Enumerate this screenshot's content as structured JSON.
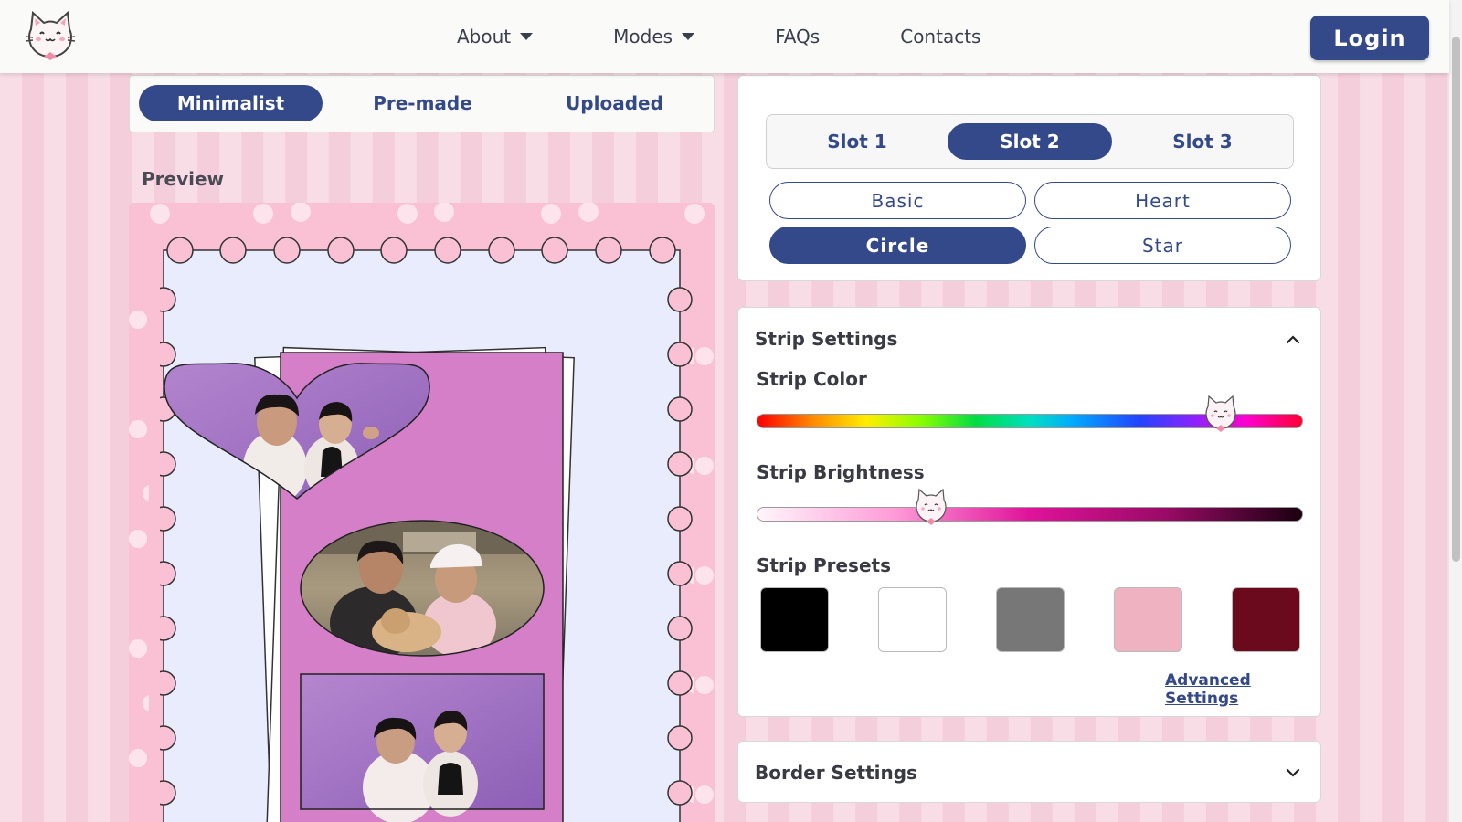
{
  "nav": {
    "items": [
      {
        "label": "About",
        "has_caret": true
      },
      {
        "label": "Modes",
        "has_caret": true
      },
      {
        "label": "FAQs",
        "has_caret": false
      },
      {
        "label": "Contacts",
        "has_caret": false
      }
    ],
    "login_label": "Login"
  },
  "mode_tabs": {
    "items": [
      "Minimalist",
      "Pre-made",
      "Uploaded"
    ],
    "active": "Minimalist"
  },
  "preview": {
    "label": "Preview",
    "strip_color": "#d47fc7",
    "frame_color": "#f9c1d3",
    "paper_color": "#e9ecfc",
    "slot_shapes": [
      "heart",
      "circle",
      "basic"
    ]
  },
  "slots": {
    "items": [
      "Slot 1",
      "Slot 2",
      "Slot 3"
    ],
    "active": "Slot 2",
    "shapes": [
      "Basic",
      "Heart",
      "Circle",
      "Star"
    ],
    "active_shape": "Circle"
  },
  "strip_settings": {
    "title": "Strip Settings",
    "expanded": true,
    "color_label": "Strip Color",
    "hue_value_fraction": 0.85,
    "brightness_label": "Strip Brightness",
    "brightness_value_fraction": 0.32,
    "presets_label": "Strip Presets",
    "presets": [
      "#000000",
      "#ffffff",
      "#777777",
      "#efb2c1",
      "#6b0a1c"
    ],
    "advanced_link": "Advanced Settings"
  },
  "border_settings": {
    "title": "Border Settings",
    "expanded": false
  },
  "colors": {
    "primary": "#34498a",
    "background_stripe_a": "#f9dde6",
    "background_stripe_b": "#f4cfdb"
  },
  "icons": {
    "logo": "cat-logo-icon",
    "caret": "caret-down-icon",
    "chevron_up": "chevron-up-icon",
    "chevron_down": "chevron-down-icon",
    "slider_thumb": "cat-face-icon"
  }
}
